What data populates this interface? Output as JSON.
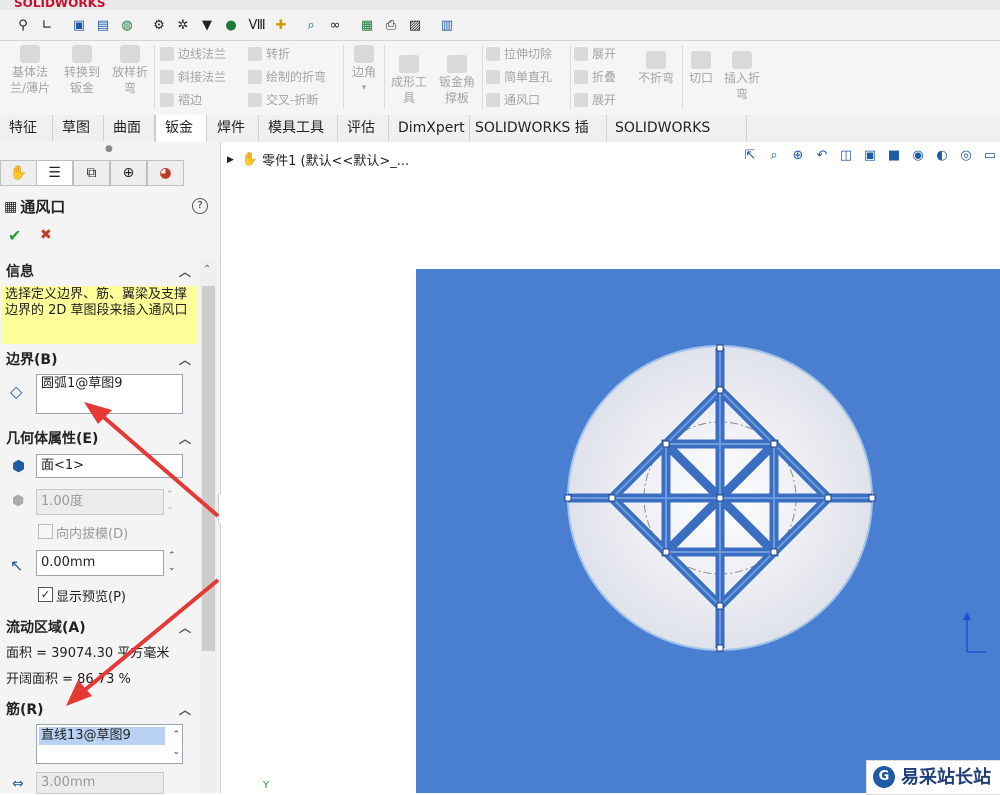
{
  "app": {
    "logo": "SOLIDWORKS"
  },
  "ribbon": {
    "base_flange": "基体法\n兰/薄片",
    "convert_to_sheetmetal": "转换到\n钣金",
    "lofted_bend": "放样折\n弯",
    "edge_flange": "边线法兰",
    "miter_flange": "斜接法兰",
    "hem": "褶边",
    "jog": "转折",
    "sketched_bend": "绘制的折弯",
    "cross_break": "交叉-折断",
    "corners": "边角",
    "forming_tool": "成形工\n具",
    "gusset": "钣金角\n撑板",
    "extruded_cut": "拉伸切除",
    "simple_hole": "简单直孔",
    "vent": "通风口",
    "unfold": "展开",
    "fold": "折叠",
    "flatten": "展开",
    "no_bends": "不折弯",
    "rip": "切口",
    "insert_bends": "插入折\n弯"
  },
  "tabs": [
    {
      "label": "特征"
    },
    {
      "label": "草图"
    },
    {
      "label": "曲面"
    },
    {
      "label": "钣金"
    },
    {
      "label": "焊件"
    },
    {
      "label": "模具工具"
    },
    {
      "label": "评估"
    },
    {
      "label": "DimXpert"
    },
    {
      "label": "SOLIDWORKS 插件"
    },
    {
      "label": "SOLIDWORKS MBD"
    }
  ],
  "panel": {
    "title": "通风口",
    "info_header": "信息",
    "info_text": "选择定义边界、筋、翼梁及支撑边界的 2D 草图段来插入通风口",
    "boundary_header": "边界(B)",
    "boundary_value": "圆弧1@草图9",
    "geometry_header": "几何体属性(E)",
    "face_value": "面<1>",
    "draft_value": "1.00度",
    "draft_inward_label": "向内拔模(D)",
    "fillet_value": "0.00mm",
    "show_preview_label": "显示预览(P)",
    "flow_header": "流动区域(A)",
    "area_text": "面积 = 39074.30 平方毫米",
    "open_area_text": "开阔面积 = 86.73 %",
    "ribs_header": "筋(R)",
    "ribs_value": "直线13@草图9",
    "rib_width_value": "3.00mm"
  },
  "viewport": {
    "tree_item": "零件1  (默认<<默认>_..."
  },
  "colors": {
    "part_blue": "#4a7ed0",
    "highlight_yellow": "#ffff99",
    "annotation_red": "#e53935"
  },
  "watermark": {
    "text": "易采站长站"
  }
}
